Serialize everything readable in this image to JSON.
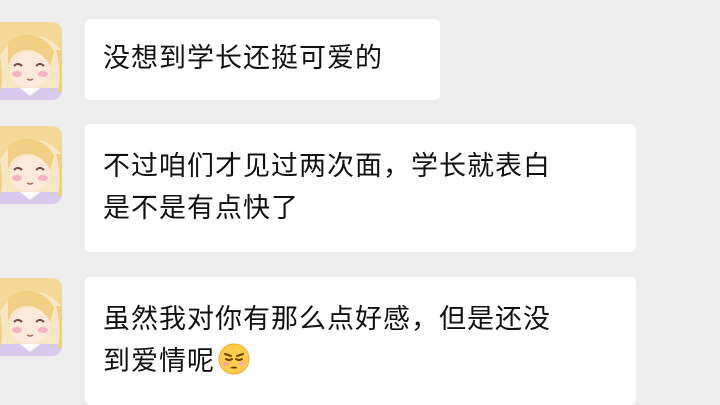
{
  "messages": [
    {
      "lines": [
        "没想到学长还挺可爱的"
      ]
    },
    {
      "lines": [
        "不过咱们才见过两次面，学长就表白",
        "是不是有点快了"
      ]
    },
    {
      "lines": [
        "虽然我对你有那么点好感，但是还没",
        "到爱情呢"
      ],
      "trailing_emoji": "pouting-face-emoji"
    }
  ],
  "avatar": {
    "icon": "anime-girl-avatar",
    "hair_color": "#f3dba0",
    "blush_color": "#f2a3b5"
  },
  "colors": {
    "background": "#ededed",
    "bubble": "#ffffff",
    "text": "#111111"
  }
}
